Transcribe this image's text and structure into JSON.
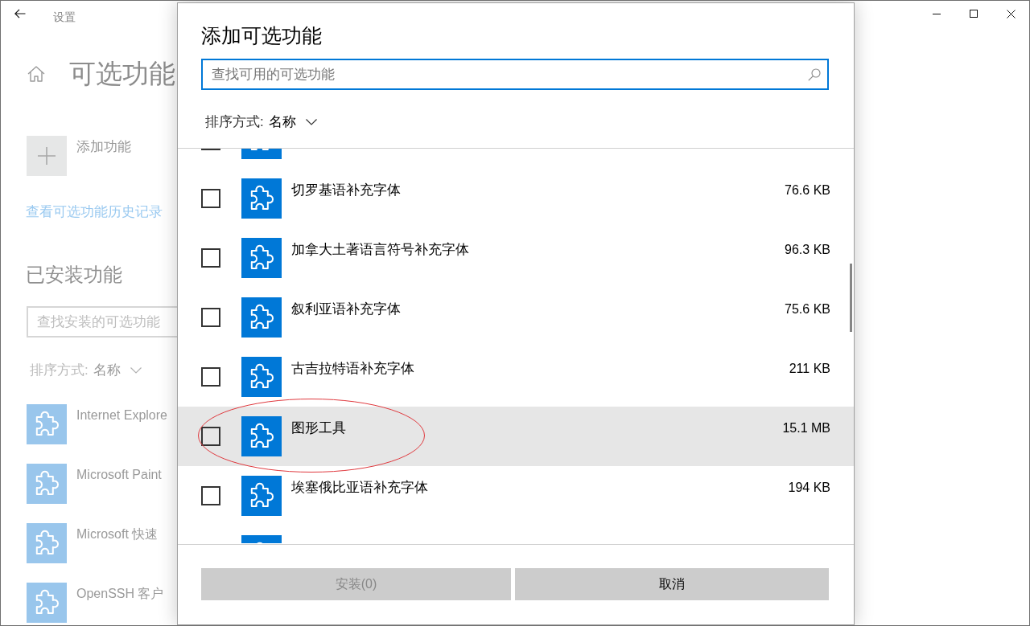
{
  "window": {
    "title": "设置"
  },
  "page": {
    "title": "可选功能",
    "add_feature": {
      "label": "添加功能"
    },
    "history_link": "查看可选功能历史记录",
    "installed": {
      "heading": "已安装功能",
      "search": {
        "placeholder": "查找安装的可选功能"
      },
      "sort": {
        "label": "排序方式:",
        "value": "名称"
      },
      "items": [
        {
          "name": "Internet Explore"
        },
        {
          "name": "Microsoft Paint"
        },
        {
          "name": "Microsoft 快速"
        },
        {
          "name": "OpenSSH 客户"
        }
      ]
    }
  },
  "dialog": {
    "title": "添加可选功能",
    "search": {
      "placeholder": "查找可用的可选功能",
      "focused": true
    },
    "sort": {
      "label": "排序方式:",
      "value": "名称"
    },
    "rows": [
      {
        "kind": "cut_top",
        "checked": false,
        "highlighted": false,
        "circled": false
      },
      {
        "kind": "full",
        "name": "切罗基语补充字体",
        "size": "76.6 KB",
        "checked": false,
        "highlighted": false,
        "circled": false
      },
      {
        "kind": "full",
        "name": "加拿大土著语言符号补充字体",
        "size": "96.3 KB",
        "checked": false,
        "highlighted": false,
        "circled": false
      },
      {
        "kind": "full",
        "name": "叙利亚语补充字体",
        "size": "75.6 KB",
        "checked": false,
        "highlighted": false,
        "circled": false
      },
      {
        "kind": "full",
        "name": "古吉拉特语补充字体",
        "size": "211 KB",
        "checked": false,
        "highlighted": false,
        "circled": false
      },
      {
        "kind": "full",
        "name": "图形工具",
        "size": "15.1 MB",
        "checked": false,
        "highlighted": true,
        "circled": true
      },
      {
        "kind": "full",
        "name": "埃塞俄比亚语补充字体",
        "size": "194 KB",
        "checked": false,
        "highlighted": false,
        "circled": false
      },
      {
        "kind": "cut_bottom",
        "highlighted": false,
        "circled": false
      }
    ],
    "buttons": [
      {
        "label": "安装(0)",
        "disabled": true
      },
      {
        "label": "取消",
        "disabled": false
      }
    ]
  }
}
